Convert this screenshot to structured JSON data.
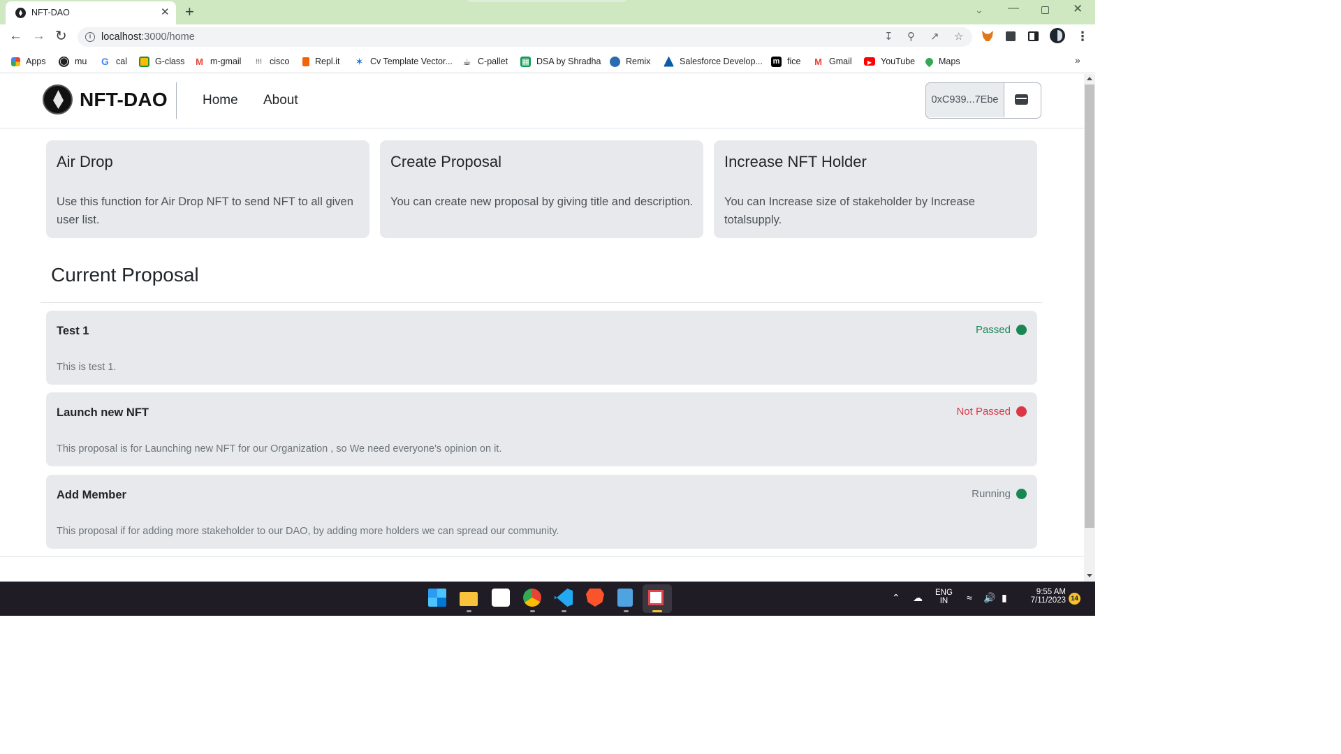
{
  "browser": {
    "tab_title": "NFT-DAO",
    "tab_close": "✕",
    "new_tab": "+",
    "url_host": "localhost",
    "url_rest": ":3000/home",
    "nav_back": "←",
    "nav_forward": "→",
    "nav_reload": "↻",
    "bookmarks": [
      {
        "label": "Apps",
        "icon": "apps-grid-icon",
        "color": "#4285f4"
      },
      {
        "label": "mu",
        "icon": "globe-icon",
        "color": "#202124"
      },
      {
        "label": "cal",
        "icon": "google-icon",
        "color": "#4285f4"
      },
      {
        "label": "G-class",
        "icon": "classroom-icon",
        "color": "#1e8e3e"
      },
      {
        "label": "m-gmail",
        "icon": "gmail-icon",
        "color": "#ea4335"
      },
      {
        "label": "cisco",
        "icon": "cisco-icon",
        "color": "#5f6368"
      },
      {
        "label": "Repl.it",
        "icon": "replit-icon",
        "color": "#f26207"
      },
      {
        "label": "Cv Template Vector...",
        "icon": "vector-icon",
        "color": "#1a73e8"
      },
      {
        "label": "C-pallet",
        "icon": "pallet-icon",
        "color": "#202124"
      },
      {
        "label": "DSA by Shradha",
        "icon": "sheets-icon",
        "color": "#0f9d58"
      },
      {
        "label": "Remix",
        "icon": "remix-icon",
        "color": "#2a6cb0"
      },
      {
        "label": "Salesforce Develop...",
        "icon": "trailhead-icon",
        "color": "#0b5cab"
      },
      {
        "label": "fice",
        "icon": "m-logo-icon",
        "color": "#000000"
      },
      {
        "label": "Gmail",
        "icon": "gmail-icon",
        "color": "#ea4335"
      },
      {
        "label": "YouTube",
        "icon": "youtube-icon",
        "color": "#ff0000"
      },
      {
        "label": "Maps",
        "icon": "maps-pin-icon",
        "color": "#34a853"
      }
    ],
    "bookmarks_more": "»"
  },
  "site": {
    "brand": "NFT-DAO",
    "nav": [
      {
        "label": "Home"
      },
      {
        "label": "About"
      }
    ],
    "wallet_address": "0xC939...7Ebe",
    "cards": [
      {
        "title": "Air Drop",
        "text": "Use this function for Air Drop NFT to send NFT to all given user list."
      },
      {
        "title": "Create Proposal",
        "text": "You can create new proposal by giving title and description."
      },
      {
        "title": "Increase NFT Holder",
        "text": "You can Increase size of stakeholder by Increase totalsupply."
      }
    ],
    "section_title": "Current Proposal",
    "proposals": [
      {
        "title": "Test 1",
        "description": "This is test 1.",
        "status": "Passed",
        "status_color": "#198754",
        "dot_color": "#198754"
      },
      {
        "title": "Launch new NFT",
        "description": "This proposal is for Launching new NFT for our Organization , so We need everyone's opinion on it.",
        "status": "Not Passed",
        "status_color": "#dc3545",
        "dot_color": "#dc3545"
      },
      {
        "title": "Add Member",
        "description": "This proposal if for adding more stakeholder to our DAO, by adding more holders we can spread our community.",
        "status": "Running",
        "status_color": "#6c757d",
        "dot_color": "#198754"
      }
    ]
  },
  "taskbar": {
    "lang_top": "ENG",
    "lang_bottom": "IN",
    "time": "9:55 AM",
    "date": "7/11/2023",
    "notification_count": "14"
  },
  "colors": {
    "tabstrip": "#cfe8c2",
    "card_bg": "#e8e9ec",
    "taskbar": "#1f1c25"
  }
}
